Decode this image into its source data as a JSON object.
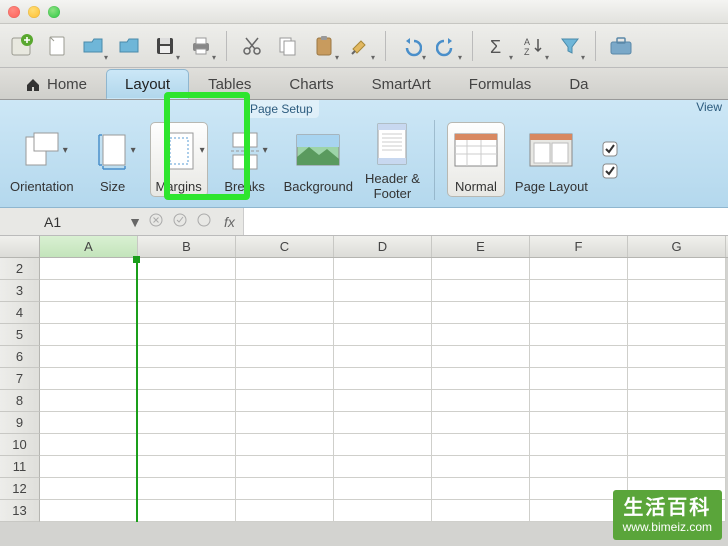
{
  "tabs": {
    "home": "Home",
    "layout": "Layout",
    "tables": "Tables",
    "charts": "Charts",
    "smartart": "SmartArt",
    "formulas": "Formulas",
    "data": "Da"
  },
  "ribbon": {
    "group_label": "Page Setup",
    "view_label": "View",
    "items": {
      "orientation": "Orientation",
      "size": "Size",
      "margins": "Margins",
      "breaks": "Breaks",
      "background": "Background",
      "header_footer": "Header &\nFooter",
      "normal": "Normal",
      "page_layout": "Page Layout"
    }
  },
  "formula_bar": {
    "namebox": "A1",
    "fx": "fx"
  },
  "grid": {
    "columns": [
      "A",
      "B",
      "C",
      "D",
      "E",
      "F",
      "G"
    ],
    "rows": [
      "2",
      "3",
      "4",
      "5",
      "6",
      "7",
      "8",
      "9",
      "10",
      "11",
      "12",
      "13"
    ]
  },
  "watermark": {
    "title": "生活百科",
    "url": "www.bimeiz.com"
  }
}
